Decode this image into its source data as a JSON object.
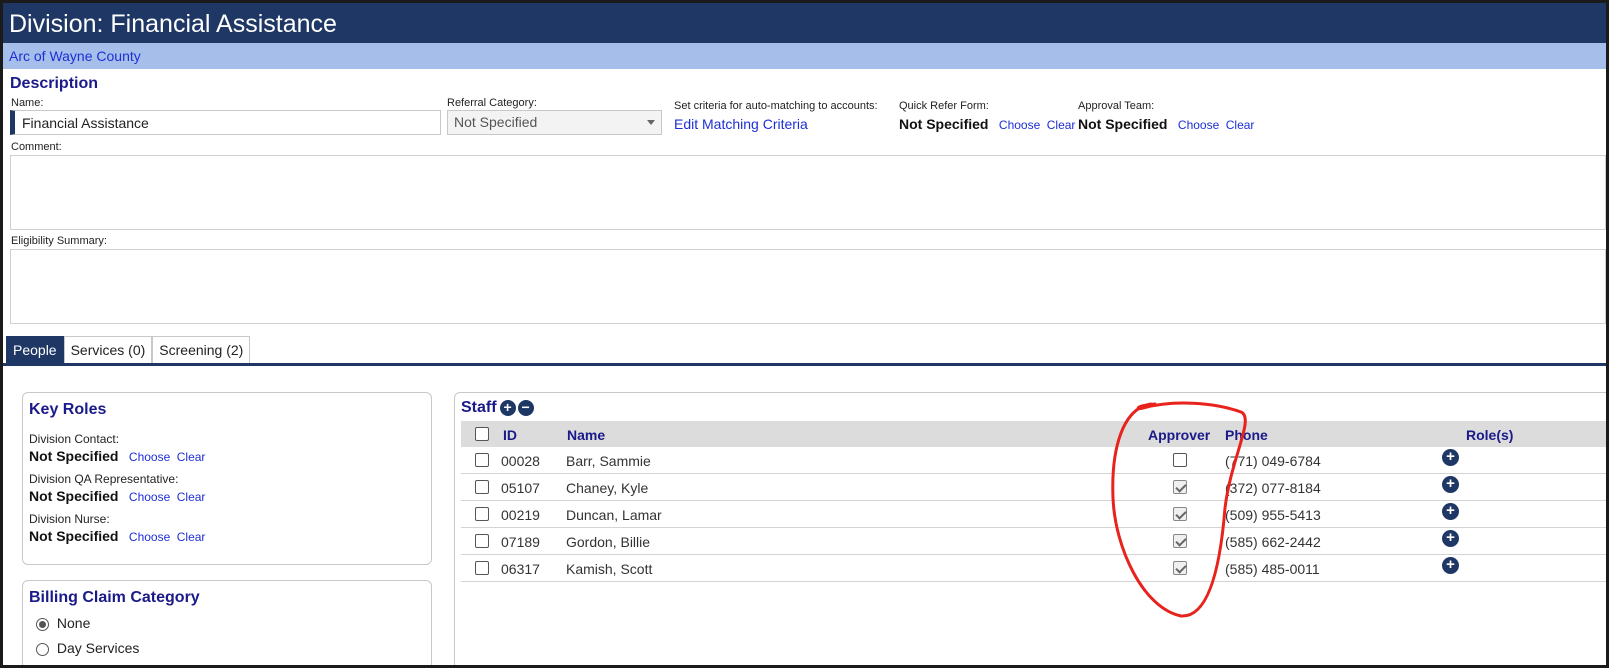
{
  "header": {
    "title": "Division: Financial Assistance",
    "org_link": "Arc of Wayne County"
  },
  "description": {
    "title": "Description",
    "name_label": "Name:",
    "name_value": "Financial Assistance",
    "referral_label": "Referral Category:",
    "referral_value": "Not Specified",
    "criteria_label": "Set criteria for auto-matching to accounts:",
    "criteria_link": "Edit Matching Criteria",
    "quick_refer_label": "Quick Refer Form:",
    "quick_refer_value": "Not Specified",
    "approval_label": "Approval Team:",
    "approval_value": "Not Specified",
    "choose": "Choose",
    "clear": "Clear",
    "comment_label": "Comment:",
    "eligibility_label": "Eligibility Summary:"
  },
  "tabs": [
    {
      "label": "People",
      "active": true
    },
    {
      "label": "Services (0)",
      "active": false
    },
    {
      "label": "Screening (2)",
      "active": false
    }
  ],
  "key_roles": {
    "title": "Key Roles",
    "roles": [
      {
        "label": "Division Contact:",
        "value": "Not Specified"
      },
      {
        "label": "Division QA Representative:",
        "value": "Not Specified"
      },
      {
        "label": "Division Nurse:",
        "value": "Not Specified"
      }
    ]
  },
  "billing": {
    "title": "Billing Claim Category",
    "options": [
      {
        "label": "None",
        "selected": true
      },
      {
        "label": "Day Services",
        "selected": false
      }
    ]
  },
  "staff": {
    "title": "Staff",
    "columns": {
      "id": "ID",
      "name": "Name",
      "approver": "Approver",
      "phone": "Phone",
      "roles": "Role(s)"
    },
    "rows": [
      {
        "id": "00028",
        "name": "Barr, Sammie",
        "approver": false,
        "phone": "(771) 049-6784"
      },
      {
        "id": "05107",
        "name": "Chaney, Kyle",
        "approver": true,
        "phone": "(372) 077-8184"
      },
      {
        "id": "00219",
        "name": "Duncan, Lamar",
        "approver": true,
        "phone": "(509) 955-5413"
      },
      {
        "id": "07189",
        "name": "Gordon, Billie",
        "approver": true,
        "phone": "(585) 662-2442"
      },
      {
        "id": "06317",
        "name": "Kamish, Scott",
        "approver": true,
        "phone": "(585) 485-0011"
      }
    ]
  },
  "colors": {
    "header_bg": "#1e3764",
    "subbar_bg": "#a6bfea",
    "link": "#1d2fd6",
    "annotation": "#e8221c"
  }
}
